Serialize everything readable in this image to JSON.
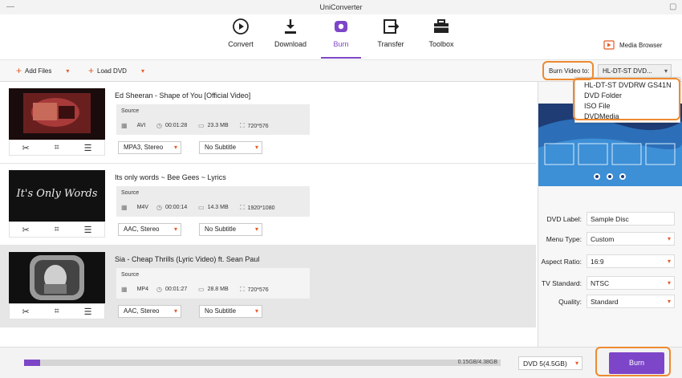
{
  "window": {
    "title": "UniConverter",
    "controls": [
      "—",
      "▢"
    ]
  },
  "nav": {
    "tabs": [
      {
        "label": "Convert",
        "icon": "convert-icon"
      },
      {
        "label": "Download",
        "icon": "download-icon"
      },
      {
        "label": "Burn",
        "icon": "burn-icon",
        "active": true
      },
      {
        "label": "Transfer",
        "icon": "transfer-icon"
      },
      {
        "label": "Toolbox",
        "icon": "toolbox-icon"
      }
    ],
    "media_browser": "Media Browser"
  },
  "toolbar": {
    "add_files": "Add Files",
    "load_dvd": "Load DVD",
    "burn_video_to_label": "Burn Video to:",
    "device_selected": "HL-DT-ST DVD..."
  },
  "device_menu": {
    "items": [
      "HL-DT-ST DVDRW GS41N",
      "DVD Folder",
      "ISO File",
      "DVDMedia"
    ]
  },
  "files": [
    {
      "title": "Ed Sheeran - Shape of You [Official Video]",
      "source_label": "Source",
      "format": "AVI",
      "duration": "00:01:28",
      "size": "23.3 MB",
      "resolution": "720*576",
      "audio": "MPA3, Stereo",
      "subtitle": "No Subtitle",
      "thumb_text": "",
      "selected": false
    },
    {
      "title": "Its only words ~ Bee Gees ~ Lyrics",
      "source_label": "Source",
      "format": "M4V",
      "duration": "00:00:14",
      "size": "14.3 MB",
      "resolution": "1920*1080",
      "audio": "AAC, Stereo",
      "subtitle": "No Subtitle",
      "thumb_text": "It's Only Words",
      "selected": false
    },
    {
      "title": "Sia - Cheap Thrills (Lyric Video) ft. Sean Paul",
      "source_label": "Source",
      "format": "MP4",
      "duration": "00:01:27",
      "size": "28.8 MB",
      "resolution": "720*576",
      "audio": "AAC, Stereo",
      "subtitle": "No Subtitle",
      "thumb_text": "",
      "selected": true
    }
  ],
  "settings": {
    "dvd_label": {
      "label": "DVD Label:",
      "value": "Sample Disc"
    },
    "menu_type": {
      "label": "Menu Type:",
      "value": "Custom"
    },
    "aspect_ratio": {
      "label": "Aspect Ratio:",
      "value": "16:9"
    },
    "tv_standard": {
      "label": "TV Standard:",
      "value": "NTSC"
    },
    "quality": {
      "label": "Quality:",
      "value": "Standard"
    }
  },
  "footer": {
    "capacity_text": "0.15GB/4.38GB",
    "progress_fraction": 0.034,
    "disc_type": "DVD 5(4.5GB)",
    "burn_label": "Burn"
  },
  "colors": {
    "accent": "#7d46c8",
    "highlight": "#ee8a30",
    "icon_orange": "#e55a25"
  }
}
